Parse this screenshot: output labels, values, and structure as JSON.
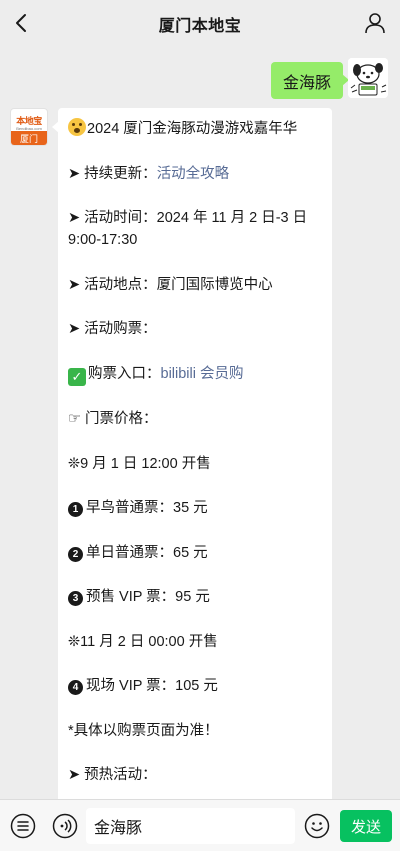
{
  "header": {
    "title": "厦门本地宝",
    "back_icon": "chevron-left-icon",
    "user_icon": "person-icon"
  },
  "outgoing": {
    "text": "金海豚"
  },
  "account": {
    "logo_text": "本地宝",
    "logo_sub": "Bendibao.com",
    "logo_city": "厦门"
  },
  "message": {
    "title": "2024 厦门金海豚动漫游戏嘉年华",
    "update_prefix": "➤ 持续更新：",
    "update_link": "活动全攻略",
    "time_line": "➤ 活动时间：2024 年 11 月 2 日-3 日 9:00-17:30",
    "place_line": "➤ 活动地点：厦门国际博览中心",
    "ticket_line": "➤ 活动购票：",
    "buy_prefix": "购票入口：",
    "buy_link": "bilibili 会员购",
    "price_line": "☞ 门票价格：",
    "sale1_line": "❊9 月 1 日 12:00 开售",
    "item1_num": "1",
    "item1": "早鸟普通票：35 元",
    "item2_num": "2",
    "item2": "单日普通票：65 元",
    "item3_num": "3",
    "item3": "预售 VIP 票：95 元",
    "sale2_line": "❊11 月 2 日 00:00 开售",
    "item4_num": "4",
    "item4": "现场 VIP 票：105 元",
    "note_line": "*具体以购票页面为准！",
    "warmup_line": "➤ 预热活动："
  },
  "input": {
    "value": "金海豚",
    "send_label": "发送",
    "menu_icon": "menu-list-icon",
    "voice_icon": "voice-icon",
    "emoji_icon": "emoji-icon"
  },
  "colors": {
    "background": "#ededed",
    "outgoing_bubble": "#95ec69",
    "send_button": "#07c160",
    "link": "#576b95",
    "logo_orange": "#e8641a"
  }
}
